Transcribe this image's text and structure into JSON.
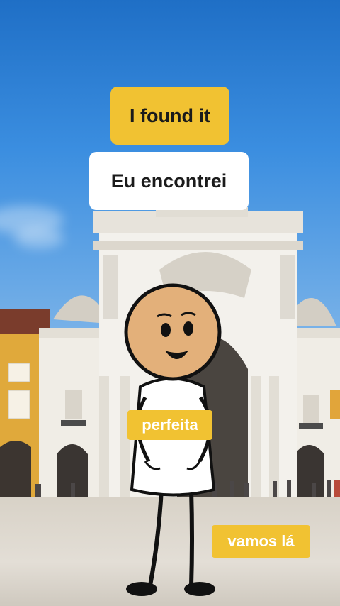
{
  "captions": {
    "english": "I found it",
    "portuguese": "Eu encontrei"
  },
  "word_tags": [
    {
      "text": "perfeita"
    },
    {
      "text": "vamos lá"
    }
  ],
  "colors": {
    "caption_yellow": "#f1c232",
    "caption_white": "#ffffff",
    "sky_blue": "#2f80d6"
  }
}
